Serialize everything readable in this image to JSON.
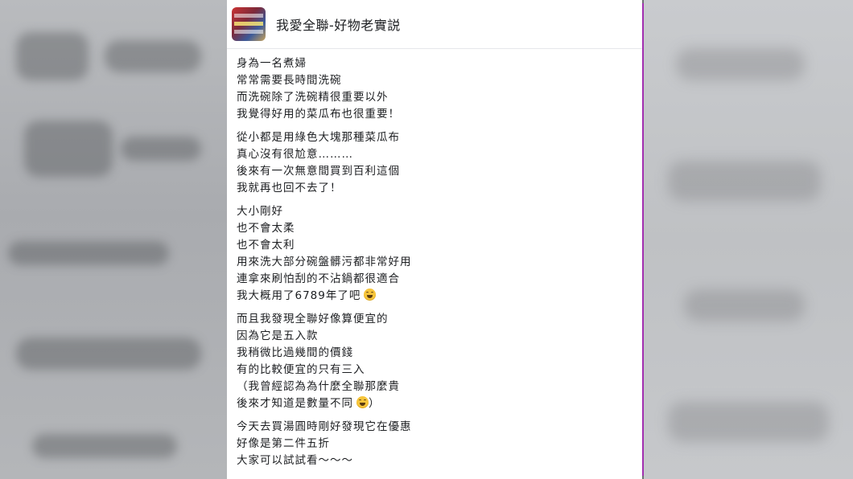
{
  "page": {
    "name": "我愛全聯-好物老實説"
  },
  "post": {
    "paragraphs": [
      [
        "身為一名煮婦",
        "常常需要長時間洗碗",
        "而洗碗除了洗碗精很重要以外",
        "我覺得好用的菜瓜布也很重要！"
      ],
      [
        "從小都是用綠色大塊那種菜瓜布",
        "真心沒有很尬意………",
        "後來有一次無意間買到百利這個",
        "我就再也回不去了！"
      ],
      [
        "大小剛好",
        "也不會太柔",
        "也不會太利",
        "用來洗大部分碗盤髒污都非常好用",
        "連拿來刷怕刮的不沾鍋都很適合",
        "我大概用了6789年了吧"
      ],
      [
        "而且我發現全聯好像算便宜的",
        "因為它是五入款",
        "我稍微比過幾間的價錢",
        "有的比較便宜的只有三入",
        "（我曾經認為為什麼全聯那麼貴",
        "後來才知道是數量不同"
      ],
      [
        "今天去買湯圓時剛好發現它在優惠",
        "好像是第二件五折",
        "大家可以試試看～～～"
      ]
    ],
    "closing_paren": "）"
  },
  "icons": {
    "emoji": "grinning-face-emoji",
    "avatar": "page-avatar"
  },
  "colors": {
    "accent_line": "#a22fb0",
    "text": "#1c1e21"
  }
}
